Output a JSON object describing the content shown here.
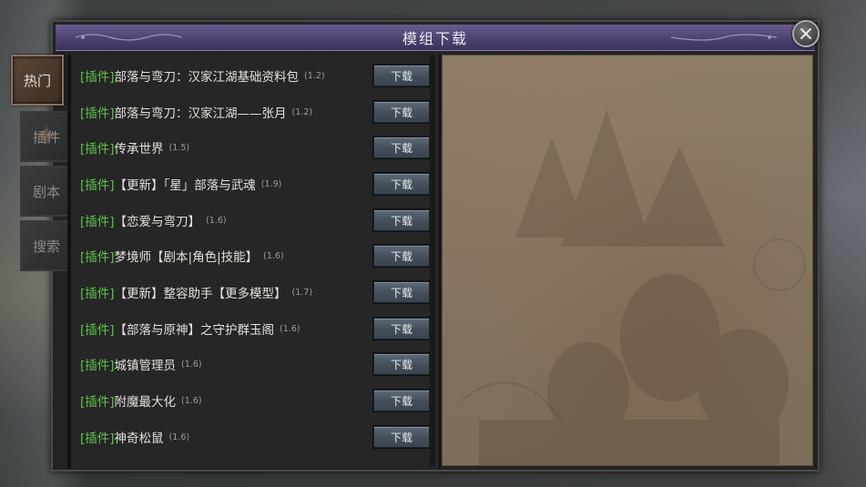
{
  "window": {
    "title": "模组下载"
  },
  "tabs": [
    {
      "label": "热门",
      "active": true
    },
    {
      "label": "插件",
      "active": false
    },
    {
      "label": "剧本",
      "active": false
    },
    {
      "label": "搜索",
      "active": false
    }
  ],
  "download_label": "下载",
  "mods": [
    {
      "tag": "[插件]",
      "name": "部落与弯刀：汉家江湖基础资料包",
      "version": "(1.2)"
    },
    {
      "tag": "[插件]",
      "name": "部落与弯刀：汉家江湖——张月",
      "version": "(1.2)"
    },
    {
      "tag": "[插件]",
      "name": "传承世界",
      "version": "(1.5)"
    },
    {
      "tag": "[插件]",
      "name": "【更新】「星」部落与武魂",
      "version": "(1.9)"
    },
    {
      "tag": "[插件]",
      "name": "【恋爱与弯刀】",
      "version": "(1.6)"
    },
    {
      "tag": "[插件]",
      "name": "梦境师【剧本|角色|技能】",
      "version": "(1.6)"
    },
    {
      "tag": "[插件]",
      "name": "【更新】整容助手【更多模型】",
      "version": "(1.7)"
    },
    {
      "tag": "[插件]",
      "name": "【部落与原神】之守护群玉阁",
      "version": "(1.6)"
    },
    {
      "tag": "[插件]",
      "name": "城镇管理员",
      "version": "(1.6)"
    },
    {
      "tag": "[插件]",
      "name": "附魔最大化",
      "version": "(1.6)"
    },
    {
      "tag": "[插件]",
      "name": "神奇松鼠",
      "version": "(1.6)"
    }
  ],
  "colors": {
    "tag_green": "#5fc44c",
    "title_purple": "#4d3f6e",
    "button_blue": "#45505c"
  }
}
